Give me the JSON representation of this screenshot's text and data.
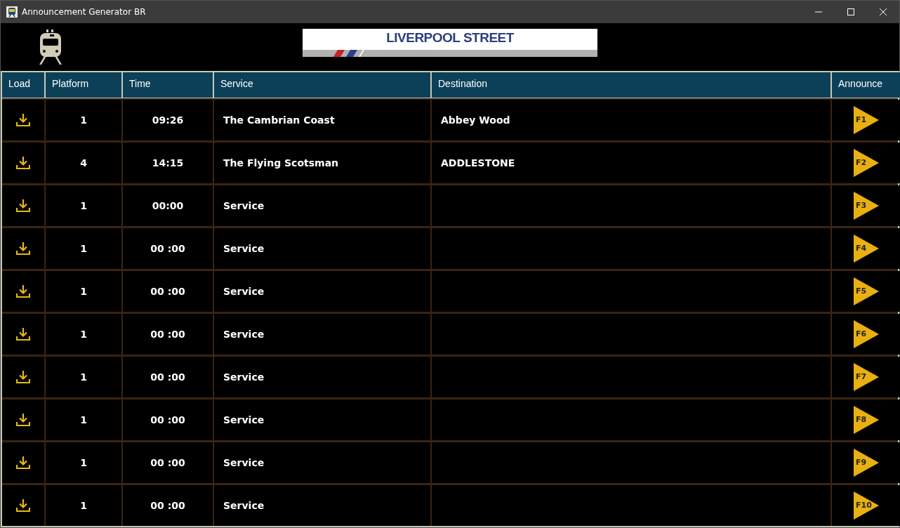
{
  "window": {
    "title": "Announcement Generator BR"
  },
  "station_sign": {
    "text": "LIVERPOOL STREET"
  },
  "table": {
    "columns": [
      "Load",
      "Platform",
      "Time",
      "Service",
      "Destination",
      "Announce"
    ],
    "rows": [
      {
        "platform": "1",
        "time": "09:26",
        "service": "The Cambrian Coast",
        "destination": "Abbey Wood",
        "announce": "F1"
      },
      {
        "platform": "4",
        "time": "14:15",
        "service": "The Flying Scotsman",
        "destination": "ADDLESTONE",
        "announce": "F2"
      },
      {
        "platform": "1",
        "time": "00:00",
        "service": "Service",
        "announce": "F3"
      },
      {
        "platform": "1",
        "time": "00 :00",
        "service": "Service",
        "announce": "F4"
      },
      {
        "platform": "1",
        "time": "00 :00",
        "service": "Service",
        "announce": "F5"
      },
      {
        "platform": "1",
        "time": "00 :00",
        "service": "Service",
        "announce": "F6"
      },
      {
        "platform": "1",
        "time": "00 :00",
        "service": "Service",
        "announce": "F7"
      },
      {
        "platform": "1",
        "time": "00 :00",
        "service": "Service",
        "announce": "F8"
      },
      {
        "platform": "1",
        "time": "00 :00",
        "service": "Service",
        "announce": "F9"
      },
      {
        "platform": "1",
        "time": "00 :00",
        "service": "Service",
        "announce": "F10"
      }
    ]
  }
}
